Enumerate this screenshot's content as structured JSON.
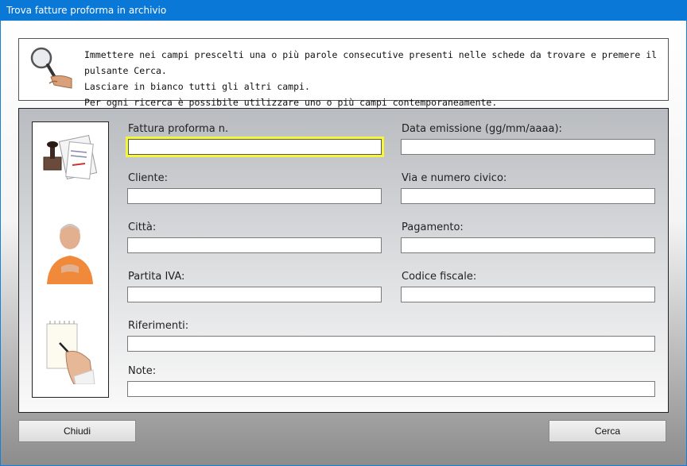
{
  "window": {
    "title": "Trova fatture proforma in archivio"
  },
  "info": {
    "lines": [
      "Immettere nei campi prescelti una o più parole consecutive presenti nelle schede da trovare e premere il pulsante Cerca.",
      "Lasciare in bianco tutti gli altri campi.",
      "Per ogni ricerca è possibile utilizzare uno o più campi contemporaneamente."
    ]
  },
  "form": {
    "fattura": {
      "label": "Fattura proforma n.",
      "value": ""
    },
    "data_emissione": {
      "label": "Data emissione (gg/mm/aaaa):",
      "value": ""
    },
    "cliente": {
      "label": "Cliente:",
      "value": ""
    },
    "via": {
      "label": "Via e numero civico:",
      "value": ""
    },
    "citta": {
      "label": "Città:",
      "value": ""
    },
    "pagamento": {
      "label": "Pagamento:",
      "value": ""
    },
    "partita_iva": {
      "label": "Partita IVA:",
      "value": ""
    },
    "codice_fiscale": {
      "label": "Codice fiscale:",
      "value": ""
    },
    "riferimenti": {
      "label": "Riferimenti:",
      "value": ""
    },
    "note": {
      "label": "Note:",
      "value": ""
    }
  },
  "buttons": {
    "close": "Chiudi",
    "search": "Cerca"
  },
  "colors": {
    "titlebar": "#0a78d7",
    "focus_border": "#f5f53a"
  }
}
